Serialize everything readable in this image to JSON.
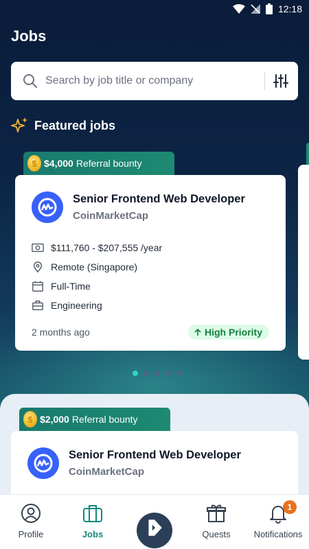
{
  "status_bar": {
    "time": "12:18"
  },
  "page": {
    "title": "Jobs"
  },
  "search": {
    "placeholder": "Search by job title or company"
  },
  "featured": {
    "heading": "Featured jobs"
  },
  "carousel": {
    "count": 5,
    "active_index": 0
  },
  "featured_job": {
    "bounty_amount": "$4,000",
    "bounty_label": "Referral bounty",
    "title": "Senior Frontend Web Developer",
    "company": "CoinMarketCap",
    "salary": "$111,760 - $207,555 /year",
    "location": "Remote (Singapore)",
    "job_type": "Full-Time",
    "department": "Engineering",
    "posted": "2 months ago",
    "priority": "High Priority"
  },
  "list_job": {
    "bounty_amount": "$2,000",
    "bounty_label": "Referral bounty",
    "title": "Senior Frontend Web Developer",
    "company": "CoinMarketCap"
  },
  "nav": {
    "profile": "Profile",
    "jobs": "Jobs",
    "quests": "Quests",
    "notifications": "Notifications",
    "notification_count": "1"
  },
  "colors": {
    "accent": "#0f8a7a",
    "brand_logo": "#3861fb",
    "badge": "#e8711c",
    "priority_bg": "#dcfce7"
  }
}
